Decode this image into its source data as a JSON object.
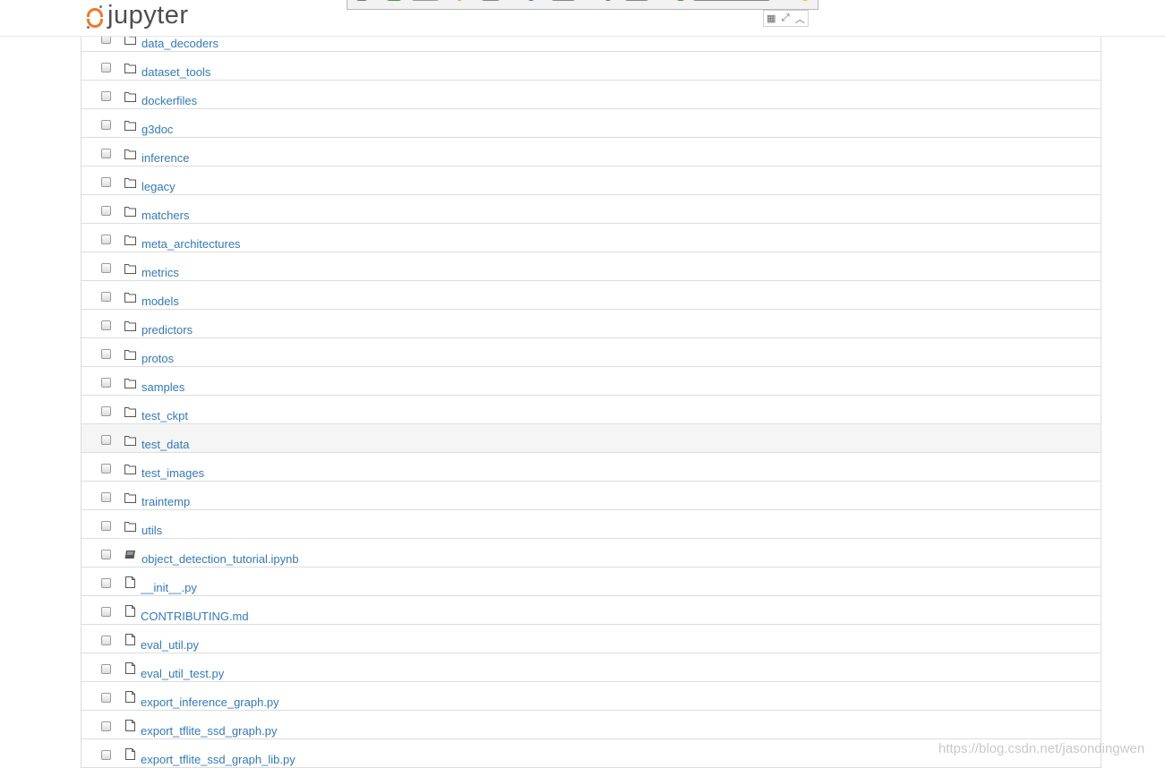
{
  "header": {
    "logo_text": "jupyter"
  },
  "rows": [
    {
      "name": "data_decoders",
      "type": "folder"
    },
    {
      "name": "dataset_tools",
      "type": "folder"
    },
    {
      "name": "dockerfiles",
      "type": "folder"
    },
    {
      "name": "g3doc",
      "type": "folder"
    },
    {
      "name": "inference",
      "type": "folder"
    },
    {
      "name": "legacy",
      "type": "folder"
    },
    {
      "name": "matchers",
      "type": "folder"
    },
    {
      "name": "meta_architectures",
      "type": "folder"
    },
    {
      "name": "metrics",
      "type": "folder"
    },
    {
      "name": "models",
      "type": "folder"
    },
    {
      "name": "predictors",
      "type": "folder"
    },
    {
      "name": "protos",
      "type": "folder"
    },
    {
      "name": "samples",
      "type": "folder"
    },
    {
      "name": "test_ckpt",
      "type": "folder"
    },
    {
      "name": "test_data",
      "type": "folder"
    },
    {
      "name": "test_images",
      "type": "folder"
    },
    {
      "name": "traintemp",
      "type": "folder"
    },
    {
      "name": "utils",
      "type": "folder"
    },
    {
      "name": "object_detection_tutorial.ipynb",
      "type": "notebook"
    },
    {
      "name": "__init__.py",
      "type": "file"
    },
    {
      "name": "CONTRIBUTING.md",
      "type": "file"
    },
    {
      "name": "eval_util.py",
      "type": "file"
    },
    {
      "name": "eval_util_test.py",
      "type": "file"
    },
    {
      "name": "export_inference_graph.py",
      "type": "file"
    },
    {
      "name": "export_tflite_ssd_graph.py",
      "type": "file"
    },
    {
      "name": "export_tflite_ssd_graph_lib.py",
      "type": "file"
    }
  ],
  "hovered_row": "test_data",
  "watermark": "https://blog.csdn.net/jasondingwen",
  "colors": {
    "link": "#337ab7",
    "logo_orange": "#f37726",
    "border": "#dddddd"
  }
}
